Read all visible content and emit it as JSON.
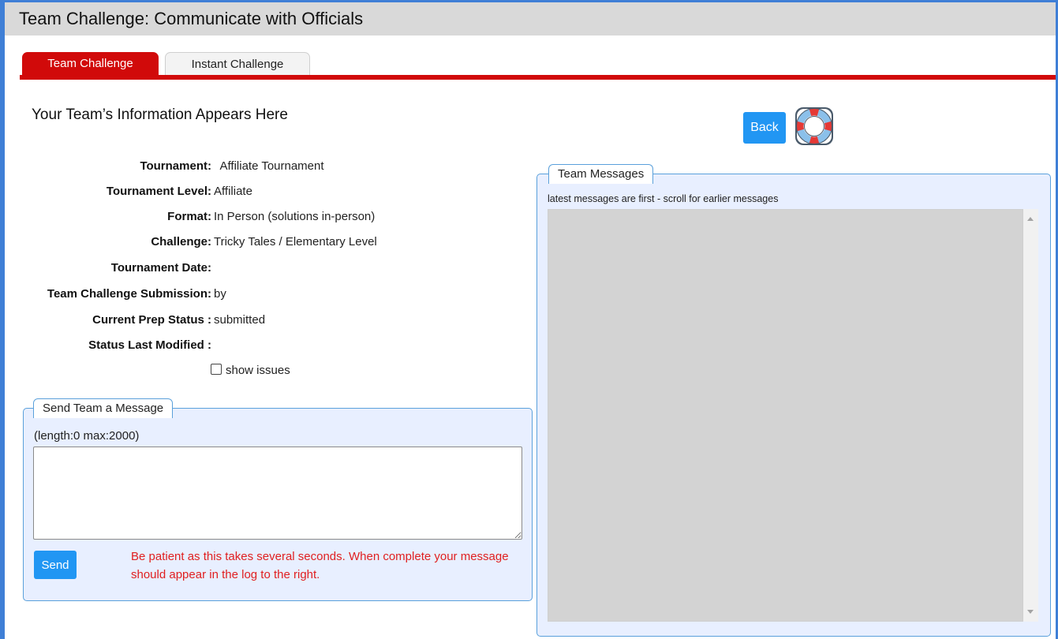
{
  "page": {
    "title": "Team Challenge: Communicate with Officials"
  },
  "tabs": [
    {
      "label": "Team Challenge",
      "active": true
    },
    {
      "label": "Instant Challenge",
      "active": false
    }
  ],
  "team_info": {
    "heading": "Your Team’s Information Appears Here",
    "fields": [
      {
        "label": "Tournament:",
        "value": "  Affiliate Tournament"
      },
      {
        "label": "Tournament Level:",
        "value": "Affiliate"
      },
      {
        "label": "Format:",
        "value": "In Person (solutions in-person)"
      },
      {
        "label": "Challenge:",
        "value": "Tricky Tales / Elementary Level"
      },
      {
        "label": "Tournament Date:",
        "value": ""
      },
      {
        "label": "Team Challenge Submission:",
        "value": "by"
      },
      {
        "label": "Current Prep Status :",
        "value": "submitted"
      },
      {
        "label": "Status Last Modified :",
        "value": ""
      }
    ],
    "show_issues_label": "show issues",
    "show_issues_checked": false
  },
  "send_message": {
    "legend": "Send Team a Message",
    "counter": "(length:0 max:2000)",
    "textarea_value": "",
    "send_label": "Send",
    "warning": "Be patient as this takes several seconds. When complete your message should appear in the log to the right."
  },
  "toolbar": {
    "back_label": "Back",
    "help_icon": "lifebuoy-icon"
  },
  "team_messages": {
    "legend": "Team Messages",
    "note": "latest messages are first - scroll for earlier messages",
    "messages": []
  },
  "colors": {
    "accent_red": "#d10a0a",
    "button_blue": "#2196f3",
    "panel_bg": "#e8efff",
    "panel_border": "#5aa0db",
    "warning_text": "#e02020"
  }
}
